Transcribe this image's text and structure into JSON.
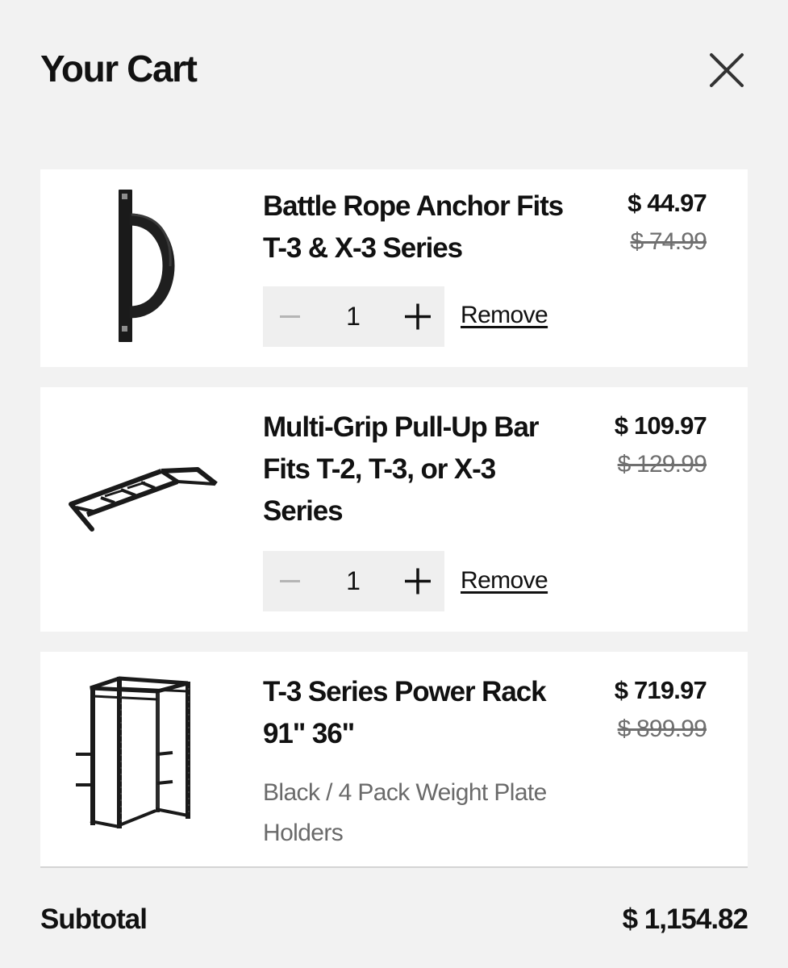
{
  "cart": {
    "title": "Your Cart"
  },
  "items": [
    {
      "name": "Battle Rope Anchor Fits T-3 & X-3 Series",
      "price": "$ 44.97",
      "compare_price": "$ 74.99",
      "quantity": "1",
      "remove_label": "Remove",
      "image_icon": "battle-rope-anchor-image"
    },
    {
      "name": "Multi-Grip Pull-Up Bar Fits T-2, T-3, or X-3 Series",
      "price": "$ 109.97",
      "compare_price": "$ 129.99",
      "quantity": "1",
      "remove_label": "Remove",
      "image_icon": "pull-up-bar-image"
    },
    {
      "name": "T-3 Series Power Rack 91\" 36\"",
      "price": "$ 719.97",
      "compare_price": "$ 899.99",
      "variant": "Black / 4 Pack Weight Plate Holders",
      "image_icon": "power-rack-image"
    }
  ],
  "summary": {
    "subtotal_label": "Subtotal",
    "subtotal_value": "$ 1,154.82"
  },
  "colors": {
    "background": "#f2f2f2",
    "card": "#ffffff",
    "stepper": "#efefef",
    "text": "#111111",
    "muted": "#6f6f6f"
  }
}
